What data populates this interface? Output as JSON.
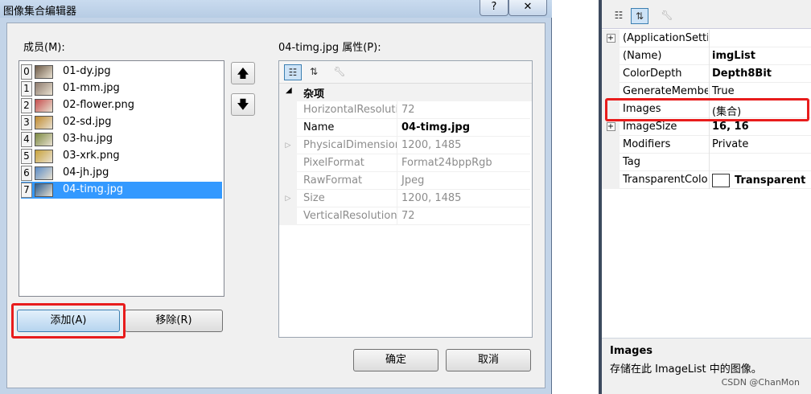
{
  "dialog": {
    "title": "图像集合编辑器",
    "help_glyph": "?",
    "close_glyph": "✕",
    "members_label": "成员(M):",
    "properties_label": "04-timg.jpg 属性(P):",
    "members": [
      {
        "index": "0",
        "name": "01-dy.jpg",
        "thumb_color": "#6d5a48"
      },
      {
        "index": "1",
        "name": "01-mm.jpg",
        "thumb_color": "#8e7b6e"
      },
      {
        "index": "2",
        "name": "02-flower.png",
        "thumb_color": "#c64f4f"
      },
      {
        "index": "3",
        "name": "02-sd.jpg",
        "thumb_color": "#c08a2e"
      },
      {
        "index": "4",
        "name": "03-hu.jpg",
        "thumb_color": "#7c8a43"
      },
      {
        "index": "5",
        "name": "03-xrk.png",
        "thumb_color": "#c8a23a"
      },
      {
        "index": "6",
        "name": "04-jh.jpg",
        "thumb_color": "#5a8bc6"
      },
      {
        "index": "7",
        "name": "04-timg.jpg",
        "thumb_color": "#2d5d8f"
      }
    ],
    "selected_index": 7,
    "move_up_glyph": "🡅",
    "move_down_glyph": "🡇",
    "category": "杂项",
    "properties": [
      {
        "name": "HorizontalResolution",
        "value": "72",
        "expand": "",
        "on": false
      },
      {
        "name": "Name",
        "value": "04-timg.jpg",
        "expand": "",
        "on": true
      },
      {
        "name": "PhysicalDimension",
        "value": "1200, 1485",
        "expand": "▷",
        "on": false
      },
      {
        "name": "PixelFormat",
        "value": "Format24bppRgb",
        "expand": "",
        "on": false
      },
      {
        "name": "RawFormat",
        "value": "Jpeg",
        "expand": "",
        "on": false
      },
      {
        "name": "Size",
        "value": "1200, 1485",
        "expand": "▷",
        "on": false
      },
      {
        "name": "VerticalResolution",
        "value": "72",
        "expand": "",
        "on": false
      }
    ],
    "add_button": "添加(A)",
    "remove_button": "移除(R)",
    "ok_button": "确定",
    "cancel_button": "取消"
  },
  "right_panel": {
    "rows": [
      {
        "expand": "+",
        "name": "(ApplicationSettings)",
        "value": "",
        "bold": false
      },
      {
        "expand": "",
        "name": "(Name)",
        "value": "imgList",
        "bold": true
      },
      {
        "expand": "",
        "name": "ColorDepth",
        "value": "Depth8Bit",
        "bold": true
      },
      {
        "expand": "",
        "name": "GenerateMember",
        "value": "True",
        "bold": false
      },
      {
        "expand": "",
        "name": "Images",
        "value": "(集合)",
        "bold": false
      },
      {
        "expand": "+",
        "name": "ImageSize",
        "value": "16, 16",
        "bold": true
      },
      {
        "expand": "",
        "name": "Modifiers",
        "value": "Private",
        "bold": false
      },
      {
        "expand": "",
        "name": "Tag",
        "value": "",
        "bold": false
      },
      {
        "expand": "",
        "name": "TransparentColor",
        "value": "Transparent",
        "bold": true
      }
    ],
    "description_title": "Images",
    "description_text": "存储在此 ImageList 中的图像。"
  },
  "watermark": "CSDN @ChanMon",
  "colors": {
    "selection": "#3399ff",
    "highlight_box": "#e81c1c"
  }
}
